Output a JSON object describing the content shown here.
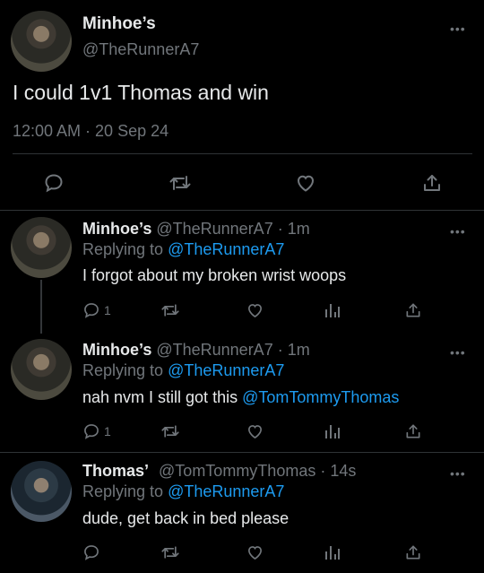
{
  "main": {
    "author_name": "Minhoe’s",
    "author_handle": "@TheRunnerA7",
    "text": "I could 1v1 Thomas and win",
    "timestamp": "12:00 AM · 20 Sep 24"
  },
  "replies": [
    {
      "name": "Minhoe’s",
      "meta": "@TheRunnerA7 · 1m",
      "replying_prefix": "Replying to",
      "replying_handle": "@TheRunnerA7",
      "text": "I forgot about my broken wrist woops",
      "mention": "",
      "reply_count": "1"
    },
    {
      "name": "Minhoe’s",
      "meta": "@TheRunnerA7 · 1m",
      "replying_prefix": "Replying to",
      "replying_handle": "@TheRunnerA7",
      "text": "nah nvm I still got this",
      "mention": "@TomTommyThomas",
      "reply_count": "1"
    },
    {
      "name": "Thomas’",
      "meta": "@TomTommyThomas · 14s",
      "replying_prefix": "Replying to",
      "replying_handle": "@TheRunnerA7",
      "text": "dude, get back in bed please",
      "mention": "",
      "reply_count": ""
    }
  ],
  "icons": {
    "more": "more-icon",
    "reply": "reply-icon",
    "retweet": "retweet-icon",
    "like": "like-icon",
    "share": "share-icon",
    "analytics": "analytics-icon"
  },
  "colors": {
    "background": "#000000",
    "text": "#e7e9ea",
    "muted": "#71767b",
    "link": "#1d9bf0"
  }
}
